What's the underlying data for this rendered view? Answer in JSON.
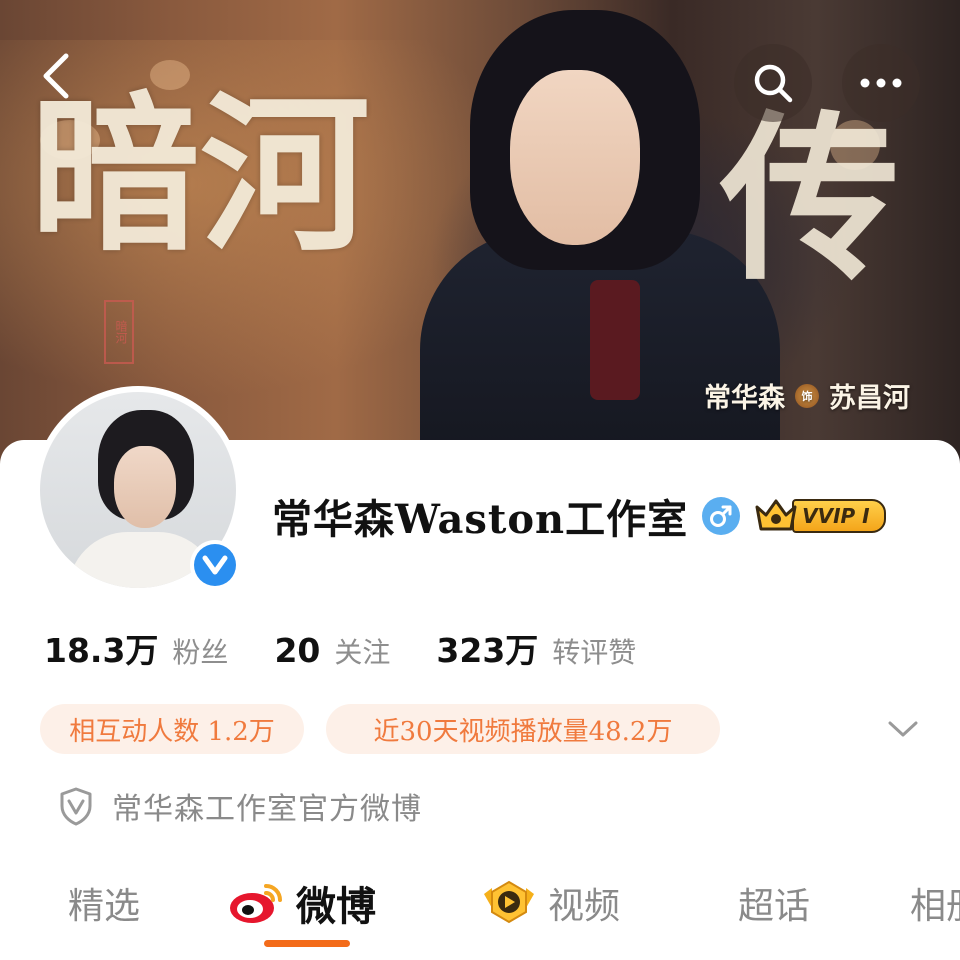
{
  "banner": {
    "drama_title_chars": [
      "暗河",
      "传"
    ],
    "seal_text": "暗河",
    "actor": "常华森",
    "role_badge": "饰",
    "role": "苏昌河"
  },
  "toolbar": {
    "back_icon": "chevron-left-icon",
    "search_icon": "search-icon",
    "more_icon": "more-dots-icon"
  },
  "profile": {
    "name": "常华森Waston工作室",
    "gender_symbol": "♂",
    "vip_label": "VVIP I",
    "verified_color": "#2b8ff0"
  },
  "stats": [
    {
      "value": "18.3万",
      "label": "粉丝"
    },
    {
      "value": "20",
      "label": "关注"
    },
    {
      "value": "323万",
      "label": "转评赞"
    }
  ],
  "pills": [
    {
      "text": "相互动人数 1.2万"
    },
    {
      "text": "近30天视频播放量48.2万"
    }
  ],
  "official": {
    "text": "常华森工作室官方微博"
  },
  "tabs": [
    {
      "label": "精选"
    },
    {
      "label": "微博"
    },
    {
      "label": "视频"
    },
    {
      "label": "超话"
    },
    {
      "label": "相册"
    }
  ],
  "colors": {
    "accent": "#f36b1a",
    "pill_bg": "#fdf0e8",
    "pill_text": "#f07a3e",
    "gender_blue": "#5aaef0",
    "vip_gold": "#ffc233"
  }
}
